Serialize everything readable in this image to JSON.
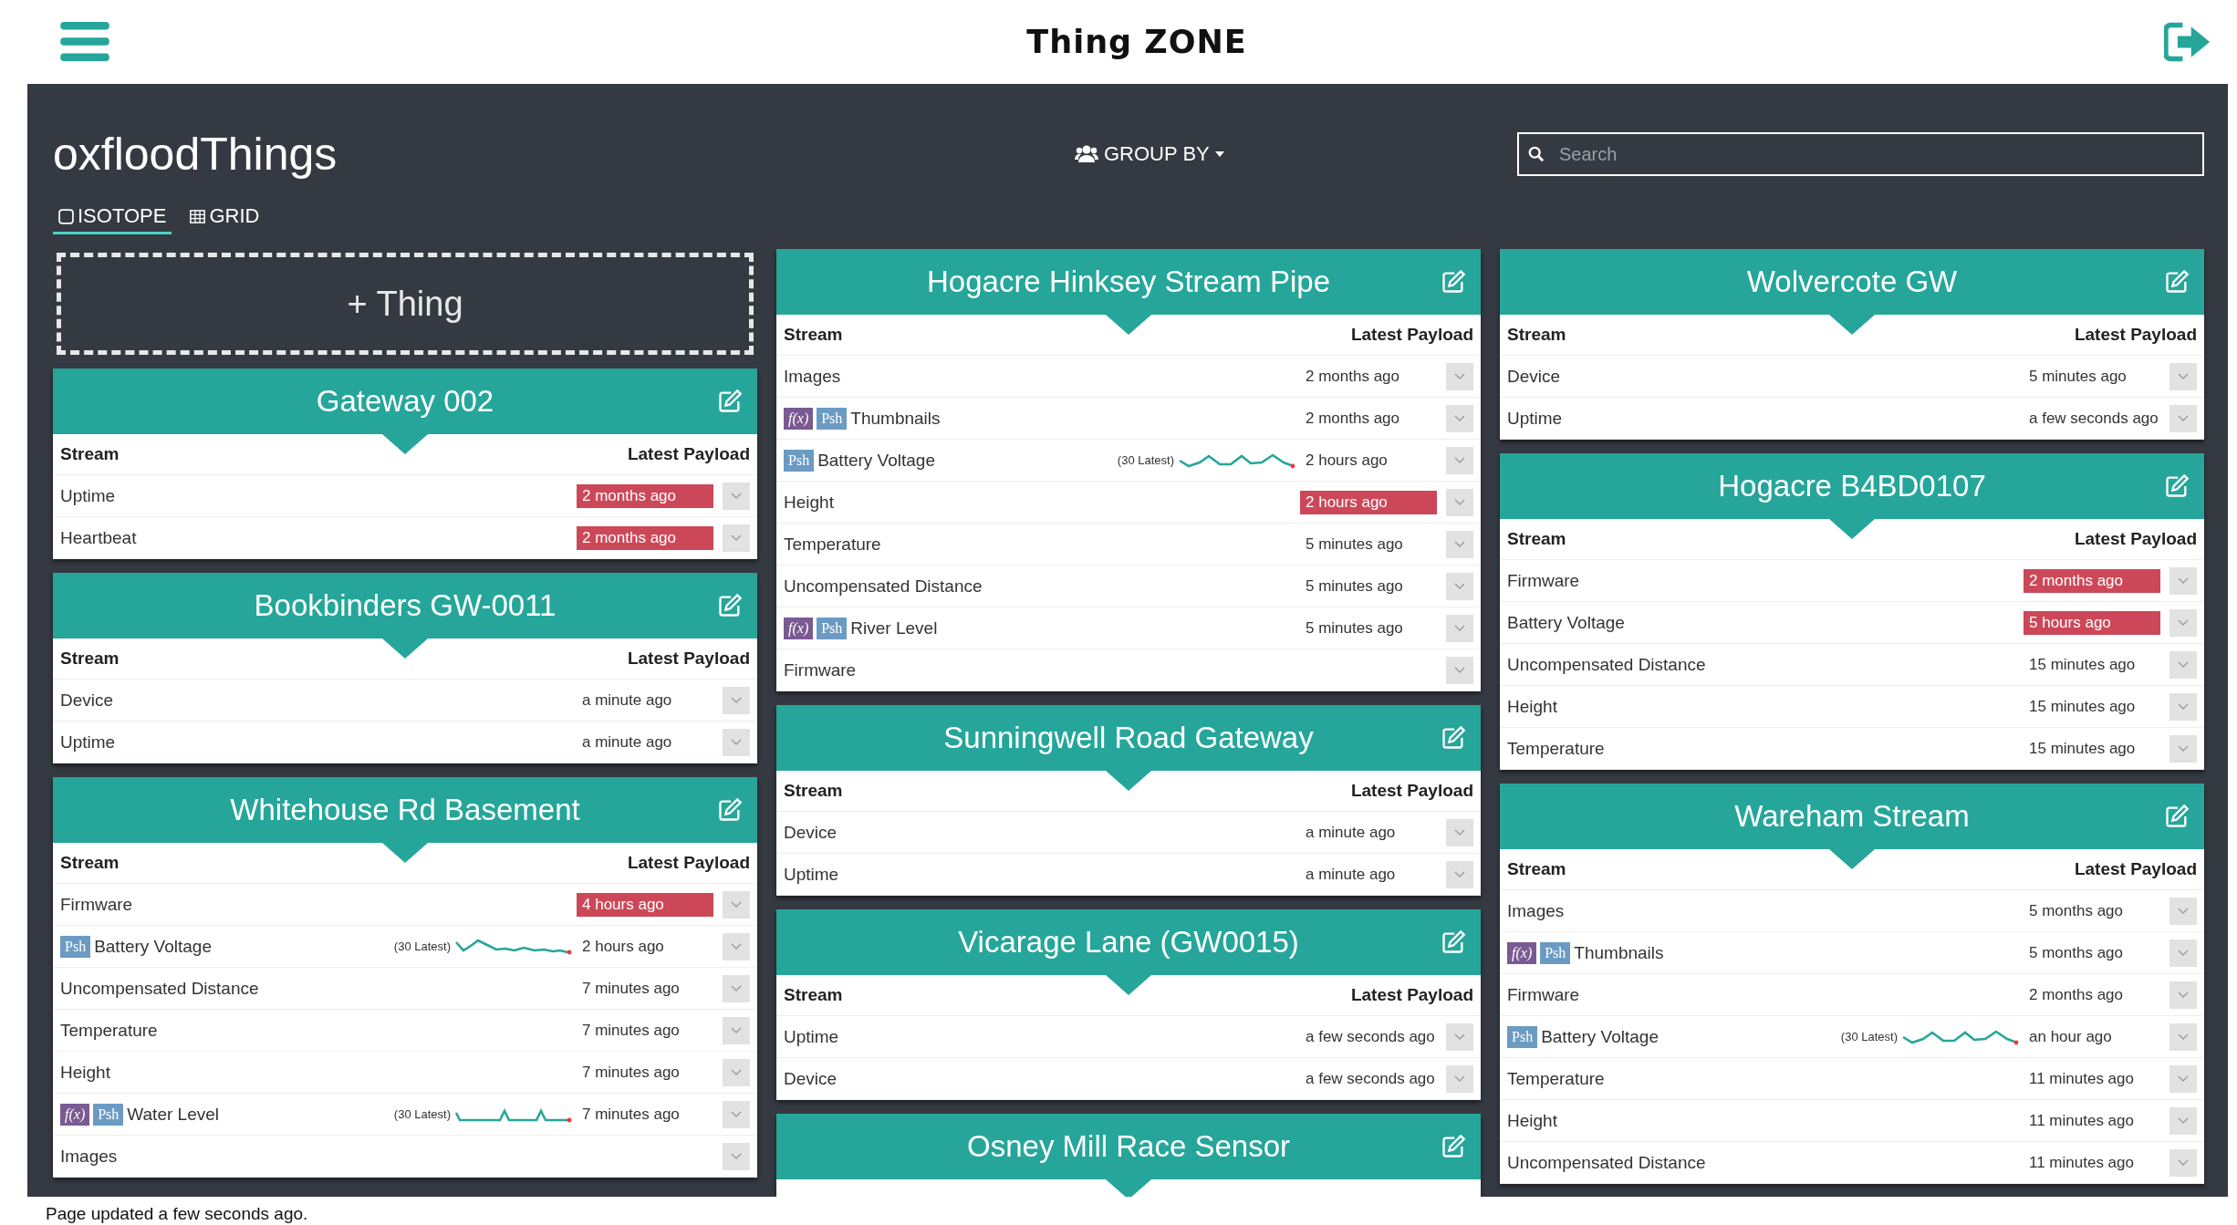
{
  "app_title": "Thing ZONE",
  "page_title": "oxfloodThings",
  "group_by": {
    "label": "GROUP BY"
  },
  "search": {
    "placeholder": "Search"
  },
  "tabs": [
    {
      "label": "ISOTOPE",
      "selected": true
    },
    {
      "label": "GRID",
      "selected": false
    }
  ],
  "add_thing": "+ Thing",
  "columns": [
    {
      "cards": [
        {
          "title": "Gateway 002",
          "headings": {
            "stream": "Stream",
            "payload": "Latest Payload"
          },
          "rows": [
            {
              "name": "Uptime",
              "badges": [],
              "time": "2 months ago",
              "stale": true
            },
            {
              "name": "Heartbeat",
              "badges": [],
              "time": "2 months ago",
              "stale": true
            }
          ]
        },
        {
          "title": "Bookbinders GW-0011",
          "headings": {
            "stream": "Stream",
            "payload": "Latest Payload"
          },
          "rows": [
            {
              "name": "Device",
              "badges": [],
              "time": "a minute ago",
              "stale": false
            },
            {
              "name": "Uptime",
              "badges": [],
              "time": "a minute ago",
              "stale": false
            }
          ]
        },
        {
          "title": "Whitehouse Rd Basement",
          "headings": {
            "stream": "Stream",
            "payload": "Latest Payload"
          },
          "rows": [
            {
              "name": "Firmware",
              "badges": [],
              "time": "4 hours ago",
              "stale": true
            },
            {
              "name": "Battery Voltage",
              "badges": [
                {
                  "kind": "push",
                  "label": "Psh"
                }
              ],
              "trend": {
                "caption": "(30 Latest)"
              },
              "time": "2 hours ago",
              "stale": false
            },
            {
              "name": "Uncompensated Distance",
              "badges": [],
              "time": "7 minutes ago",
              "stale": false
            },
            {
              "name": "Temperature",
              "badges": [],
              "time": "7 minutes ago",
              "stale": false
            },
            {
              "name": "Height",
              "badges": [],
              "time": "7 minutes ago",
              "stale": false
            },
            {
              "name": "Water Level",
              "badges": [
                {
                  "kind": "function",
                  "label": "f(x)"
                },
                {
                  "kind": "push",
                  "label": "Psh"
                }
              ],
              "trend": {
                "caption": "(30 Latest)"
              },
              "time": "7 minutes ago",
              "stale": false
            },
            {
              "name": "Images",
              "badges": []
            }
          ]
        }
      ]
    },
    {
      "cards": [
        {
          "title": "Hogacre Hinksey Stream Pipe",
          "headings": {
            "stream": "Stream",
            "payload": "Latest Payload"
          },
          "rows": [
            {
              "name": "Images",
              "badges": [],
              "time": "2 months ago",
              "stale": false
            },
            {
              "name": "Thumbnails",
              "badges": [
                {
                  "kind": "function",
                  "label": "f(x)"
                },
                {
                  "kind": "push",
                  "label": "Psh"
                }
              ],
              "time": "2 months ago",
              "stale": false
            },
            {
              "name": "Battery Voltage",
              "badges": [
                {
                  "kind": "push",
                  "label": "Psh"
                }
              ],
              "trend": {
                "caption": "(30 Latest)"
              },
              "time": "2 hours ago",
              "stale": false
            },
            {
              "name": "Height",
              "badges": [],
              "time": "2 hours ago",
              "stale": true
            },
            {
              "name": "Temperature",
              "badges": [],
              "time": "5 minutes ago",
              "stale": false
            },
            {
              "name": "Uncompensated Distance",
              "badges": [],
              "time": "5 minutes ago",
              "stale": false
            },
            {
              "name": "River Level",
              "badges": [
                {
                  "kind": "function",
                  "label": "f(x)"
                },
                {
                  "kind": "push",
                  "label": "Psh"
                }
              ],
              "time": "5 minutes ago",
              "stale": false
            },
            {
              "name": "Firmware",
              "badges": []
            }
          ]
        },
        {
          "title": "Sunningwell Road Gateway",
          "headings": {
            "stream": "Stream",
            "payload": "Latest Payload"
          },
          "rows": [
            {
              "name": "Device",
              "badges": [],
              "time": "a minute ago",
              "stale": false
            },
            {
              "name": "Uptime",
              "badges": [],
              "time": "a minute ago",
              "stale": false
            }
          ]
        },
        {
          "title": "Vicarage Lane (GW0015)",
          "headings": {
            "stream": "Stream",
            "payload": "Latest Payload"
          },
          "rows": [
            {
              "name": "Uptime",
              "badges": [],
              "time": "a few seconds ago",
              "stale": false
            },
            {
              "name": "Device",
              "badges": [],
              "time": "a few seconds ago",
              "stale": false
            }
          ]
        },
        {
          "title": "Osney Mill Race Sensor"
        }
      ]
    },
    {
      "cards": [
        {
          "title": "Wolvercote GW",
          "headings": {
            "stream": "Stream",
            "payload": "Latest Payload"
          },
          "rows": [
            {
              "name": "Device",
              "badges": [],
              "time": "5 minutes ago",
              "stale": false
            },
            {
              "name": "Uptime",
              "badges": [],
              "time": "a few seconds ago",
              "stale": false
            }
          ]
        },
        {
          "title": "Hogacre B4BD0107",
          "headings": {
            "stream": "Stream",
            "payload": "Latest Payload"
          },
          "rows": [
            {
              "name": "Firmware",
              "badges": [],
              "time": "2 months ago",
              "stale": true
            },
            {
              "name": "Battery Voltage",
              "badges": [],
              "time": "5 hours ago",
              "stale": true
            },
            {
              "name": "Uncompensated Distance",
              "badges": [],
              "time": "15 minutes ago",
              "stale": false
            },
            {
              "name": "Height",
              "badges": [],
              "time": "15 minutes ago",
              "stale": false
            },
            {
              "name": "Temperature",
              "badges": [],
              "time": "15 minutes ago",
              "stale": false
            }
          ]
        },
        {
          "title": "Wareham Stream",
          "headings": {
            "stream": "Stream",
            "payload": "Latest Payload"
          },
          "rows": [
            {
              "name": "Images",
              "badges": [],
              "time": "5 months ago",
              "stale": false
            },
            {
              "name": "Thumbnails",
              "badges": [
                {
                  "kind": "function",
                  "label": "f(x)"
                },
                {
                  "kind": "push",
                  "label": "Psh"
                }
              ],
              "time": "5 months ago",
              "stale": false
            },
            {
              "name": "Firmware",
              "badges": [],
              "time": "2 months ago",
              "stale": false
            },
            {
              "name": "Battery Voltage",
              "badges": [
                {
                  "kind": "push",
                  "label": "Psh"
                }
              ],
              "trend": {
                "caption": "(30 Latest)"
              },
              "time": "an hour ago",
              "stale": false
            },
            {
              "name": "Temperature",
              "badges": [],
              "time": "11 minutes ago",
              "stale": false
            },
            {
              "name": "Height",
              "badges": [],
              "time": "11 minutes ago",
              "stale": false
            },
            {
              "name": "Uncompensated Distance",
              "badges": [],
              "time": "11 minutes ago",
              "stale": false
            }
          ]
        }
      ]
    }
  ],
  "status": "Page updated a few seconds ago."
}
